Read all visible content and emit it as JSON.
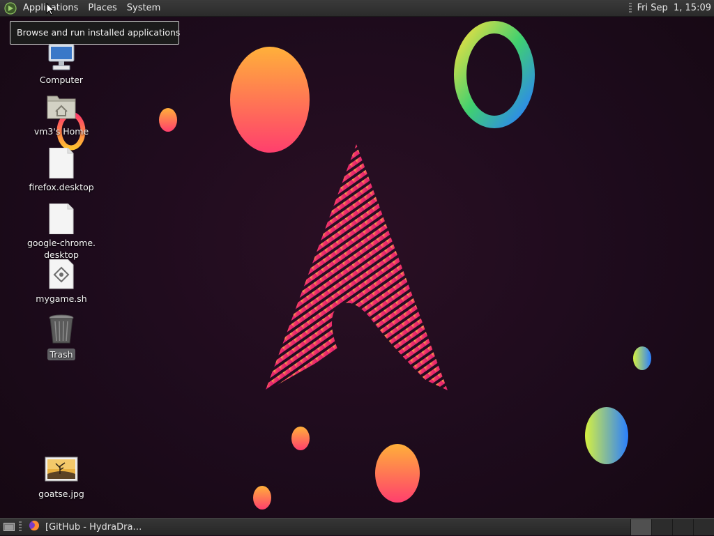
{
  "top_panel": {
    "menus": [
      "Applications",
      "Places",
      "System"
    ],
    "clock": "Fri Sep  1, 15:09"
  },
  "tooltip": {
    "text": "Browse and run installed applications"
  },
  "desktop_icons": [
    {
      "label": "Computer",
      "icon": "computer-icon"
    },
    {
      "label": "vm3's Home",
      "icon": "home-folder-icon"
    },
    {
      "label": "firefox.desktop",
      "icon": "file-icon"
    },
    {
      "label": "google-chrome.\ndesktop",
      "label_line1": "google-chrome.",
      "label_line2": "desktop",
      "icon": "file-icon"
    },
    {
      "label": "mygame.sh",
      "icon": "script-icon"
    },
    {
      "label": "Trash",
      "icon": "trash-icon"
    },
    {
      "label": "goatse.jpg",
      "icon": "image-file-icon"
    }
  ],
  "bottom_panel": {
    "task_title": "[GitHub - HydraDra…",
    "task_icon": "firefox-icon"
  },
  "colors": {
    "wallpaper_bg": "#1d0b1c",
    "panel_bg": "#2f2f2f",
    "accent_pink": "#e8206e",
    "accent_orange": "#ffa040"
  }
}
